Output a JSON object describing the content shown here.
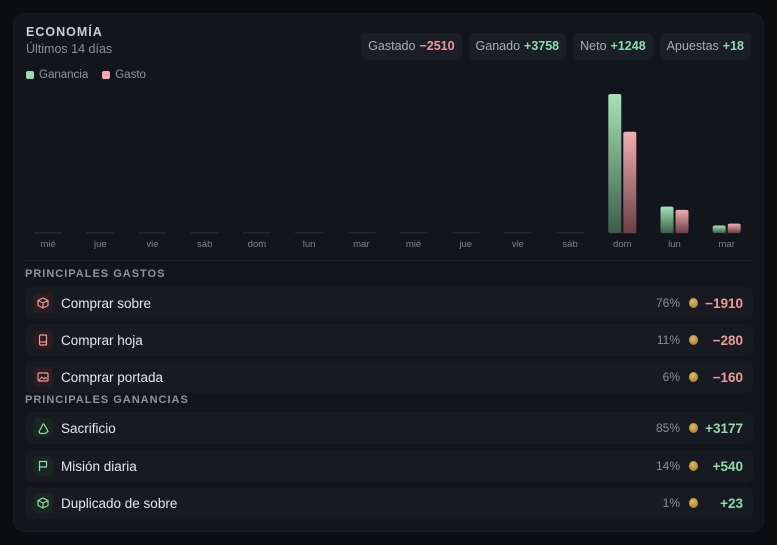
{
  "header": {
    "title": "ECONOMÍA",
    "subtitle": "Últimos 14 días"
  },
  "stats": [
    {
      "label": "Gastado",
      "value": "−2510",
      "color": "#ef9a9a"
    },
    {
      "label": "Ganado",
      "value": "+3758",
      "color": "#8fdcaa"
    },
    {
      "label": "Neto",
      "value": "+1248",
      "color": "#8fdcaa"
    },
    {
      "label": "Apuestas",
      "value": "+18",
      "color": "#8fdcaa"
    }
  ],
  "legend": [
    {
      "name": "Ganancia",
      "color": "#9fd9b2"
    },
    {
      "name": "Gasto",
      "color": "#f0a8ac"
    }
  ],
  "chart_data": {
    "type": "bar",
    "categories": [
      "mié",
      "jue",
      "vie",
      "sáb",
      "dom",
      "lun",
      "mar",
      "mié",
      "jue",
      "vie",
      "sáb",
      "dom",
      "lun",
      "mar"
    ],
    "series": [
      {
        "name": "Ganancia",
        "values": [
          0,
          0,
          0,
          0,
          0,
          0,
          0,
          0,
          0,
          0,
          0,
          2950,
          560,
          160
        ]
      },
      {
        "name": "Gasto",
        "values": [
          0,
          0,
          0,
          0,
          0,
          0,
          0,
          0,
          0,
          0,
          0,
          2150,
          490,
          200
        ]
      }
    ],
    "ylim": [
      0,
      2950
    ],
    "grid": false,
    "legend_position": "top-left"
  },
  "spending": {
    "title": "PRINCIPALES GASTOS",
    "items": [
      {
        "icon": "package-icon",
        "label": "Comprar sobre",
        "pct": "76%",
        "amount": "−1910"
      },
      {
        "icon": "page-icon",
        "label": "Comprar hoja",
        "pct": "11%",
        "amount": "−280"
      },
      {
        "icon": "image-icon",
        "label": "Comprar portada",
        "pct": "6%",
        "amount": "−160"
      }
    ]
  },
  "earnings": {
    "title": "PRINCIPALES GANANCIAS",
    "items": [
      {
        "icon": "recycle-icon",
        "label": "Sacrificio",
        "pct": "85%",
        "amount": "+3177"
      },
      {
        "icon": "flag-icon",
        "label": "Misión diaria",
        "pct": "14%",
        "amount": "+540"
      },
      {
        "icon": "duplicate-package-icon",
        "label": "Duplicado de sobre",
        "pct": "1%",
        "amount": "+23"
      }
    ]
  }
}
